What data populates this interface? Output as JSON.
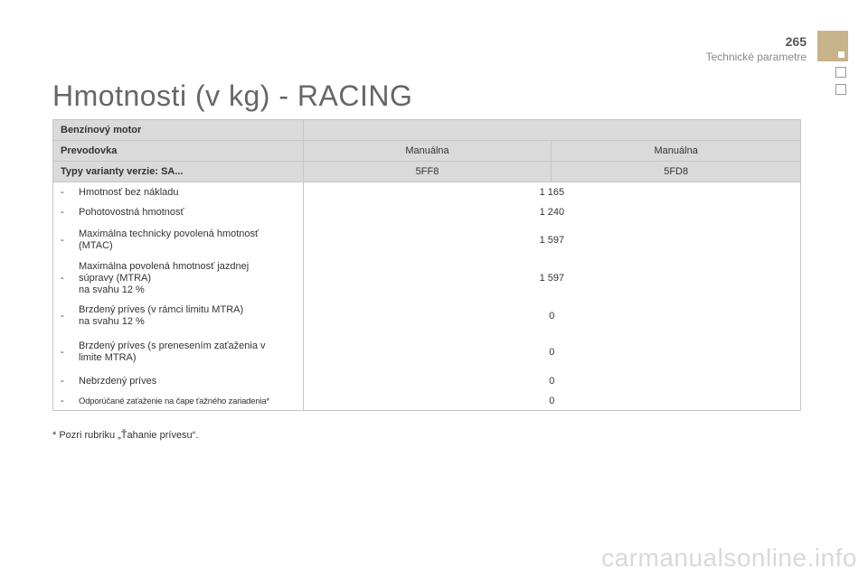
{
  "header": {
    "page_number": "265",
    "section": "Technické parametre"
  },
  "title": "Hmotnosti (v kg) - RACING",
  "table": {
    "engine_label": "Benzínový motor",
    "gearbox_label": "Prevodovka",
    "gearbox_values": [
      "Manuálna",
      "Manuálna"
    ],
    "variant_label": "Typy varianty verzie: SA...",
    "variant_values": [
      "5FF8",
      "5FD8"
    ],
    "rows": [
      {
        "dash": "-",
        "label": "Hmotnosť bez nákladu",
        "value": "1 165"
      },
      {
        "dash": "-",
        "label": "Pohotovostná hmotnosť",
        "value": "1 240"
      },
      {
        "dash": "-",
        "label": "Maximálna technicky povolená hmotnosť\n(MTAC)",
        "value": "1 597"
      },
      {
        "dash": "-",
        "label": "Maximálna povolená hmotnosť jazdnej\nsúpravy (MTRA)\nna svahu 12 %",
        "value": "1 597"
      },
      {
        "dash": "-",
        "label": "Brzdený príves (v rámci limitu MTRA)\nna svahu 12 %",
        "value": "0"
      },
      {
        "dash": "-",
        "label": "Brzdený príves (s prenesením zaťaženia v\nlimite MTRA)",
        "value": "0"
      },
      {
        "dash": "-",
        "label": "Nebrzdený príves",
        "value": "0"
      },
      {
        "dash": "-",
        "label": "Odporúčané zaťaženie na čape ťažného zariadenia*",
        "value": "0"
      }
    ]
  },
  "footnote": "* Pozri rubriku „Ťahanie prívesu“.",
  "watermark": "carmanualsonline.info"
}
